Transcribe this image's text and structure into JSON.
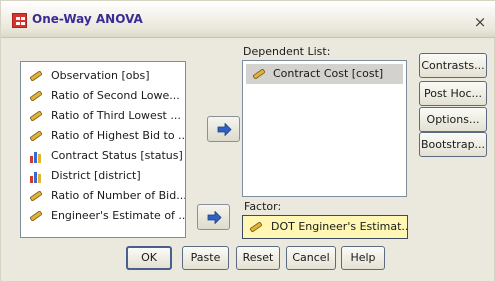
{
  "window": {
    "title": "One-Way ANOVA",
    "close_glyph": "×"
  },
  "source_list": {
    "items": [
      {
        "label": "Observation [obs]",
        "icon": "scale-ruler-icon"
      },
      {
        "label": "Ratio of Second Lowe...",
        "icon": "scale-ruler-icon"
      },
      {
        "label": "Ratio of Third Lowest ...",
        "icon": "scale-ruler-icon"
      },
      {
        "label": "Ratio of Highest Bid to ...",
        "icon": "scale-ruler-icon"
      },
      {
        "label": "Contract Status [status]",
        "icon": "nominal-bars-icon"
      },
      {
        "label": "District [district]",
        "icon": "nominal-bars-icon"
      },
      {
        "label": "Ratio of Number of Bid...",
        "icon": "scale-ruler-icon"
      },
      {
        "label": "Engineer's Estimate of ...",
        "icon": "scale-ruler-icon"
      }
    ]
  },
  "dependent_list": {
    "label": "Dependent List:",
    "items": [
      {
        "label": "Contract Cost [cost]",
        "icon": "scale-ruler-icon"
      }
    ]
  },
  "factor": {
    "label": "Factor:",
    "value": "DOT Engineer's Estimat...",
    "icon": "scale-ruler-icon"
  },
  "side_buttons": {
    "contrasts": "Contrasts...",
    "post_hoc": "Post Hoc...",
    "options": "Options...",
    "bootstrap": "Bootstrap..."
  },
  "bottom_buttons": {
    "ok": "OK",
    "paste": "Paste",
    "reset": "Reset",
    "cancel": "Cancel",
    "help": "Help"
  },
  "colors": {
    "dialog_bg": "#ebe9de",
    "title_text": "#3a2c93",
    "factor_highlight": "#fff7b3",
    "arrow_blue": "#2f62c2"
  }
}
